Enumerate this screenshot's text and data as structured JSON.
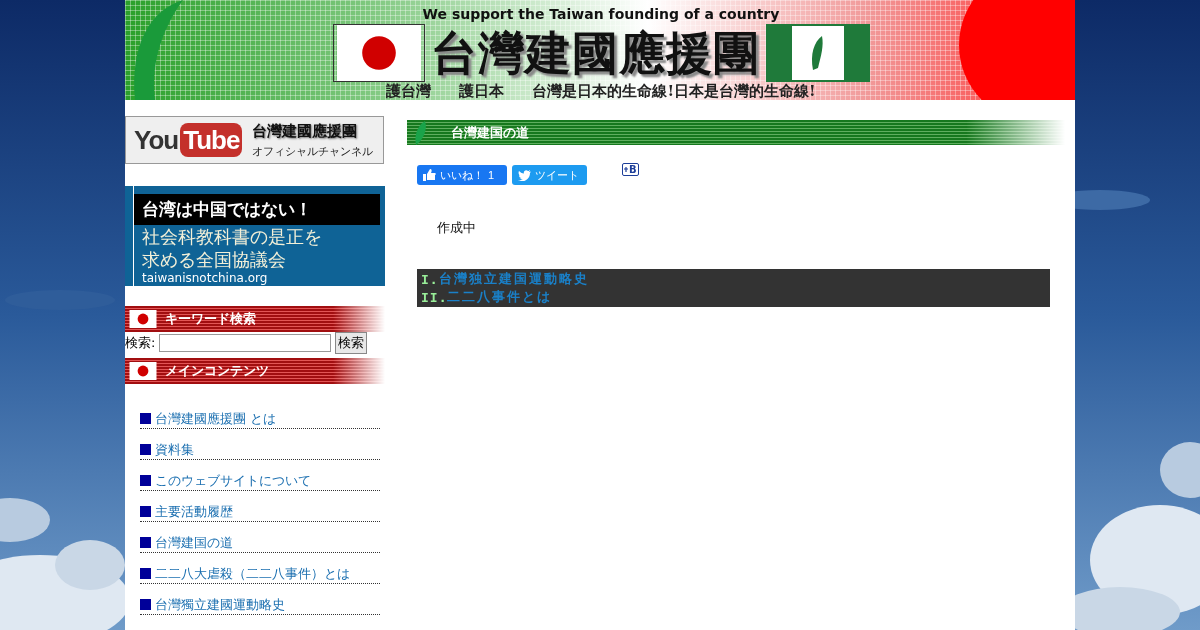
{
  "banner": {
    "tagline": "We support the Taiwan founding of a country",
    "title": "台灣建國應援團",
    "mottos": [
      "護台灣",
      "護日本",
      "台灣是日本的生命線!日本是台灣的生命線!"
    ]
  },
  "sidebar": {
    "youtube_banner": {
      "logo_you": "You",
      "logo_tube": "Tube",
      "title": "台灣建國應援團",
      "subtitle": "オフィシャルチャンネル"
    },
    "ad_banner": {
      "headline": "台湾は中国ではない！",
      "lines": [
        "社会科教科書の是正を",
        "求める全国協議会"
      ],
      "url": "taiwanisnotchina.org"
    },
    "search_section": {
      "heading": "キーワード検索",
      "label": "検索:",
      "button": "検索"
    },
    "contents_section": {
      "heading": "メインコンテンツ",
      "items": [
        {
          "label": "台灣建國應援團 とは"
        },
        {
          "label": "資料集"
        },
        {
          "label": "このウェブサイトについて"
        },
        {
          "label": "主要活動履歴"
        },
        {
          "label": "台灣建国の道"
        },
        {
          "label": "二二八大虐殺（二二八事件）とは"
        },
        {
          "label": "台灣獨立建國運動略史"
        }
      ]
    }
  },
  "main": {
    "heading": "台灣建国の道",
    "share": {
      "like_label": "いいね！",
      "like_count": "1",
      "tweet": "ツイート",
      "bookmark": "B"
    },
    "body": "作成中",
    "toc": [
      {
        "numeral": "I.",
        "text": "台灣独立建国運動略史"
      },
      {
        "numeral": "II.",
        "text": "二二八事件とは"
      }
    ]
  }
}
